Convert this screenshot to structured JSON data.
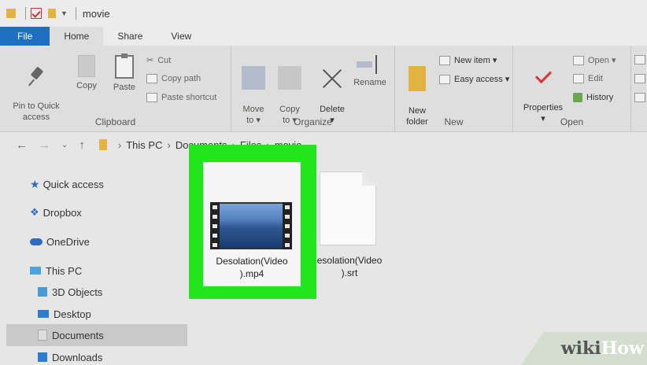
{
  "window": {
    "title": "movie"
  },
  "ribbon": {
    "tabs": [
      "File",
      "Home",
      "Share",
      "View"
    ],
    "clipboard": {
      "label": "Clipboard",
      "pin": "Pin to Quick\naccess",
      "copy": "Copy",
      "paste": "Paste",
      "cut": "Cut",
      "copy_path": "Copy path",
      "paste_shortcut": "Paste shortcut"
    },
    "organize": {
      "label": "Organize",
      "move_to": "Move\nto ▾",
      "copy_to": "Copy\nto ▾",
      "delete": "Delete\n▾",
      "rename": "Rename"
    },
    "new": {
      "label": "New",
      "new_folder": "New\nfolder",
      "new_item": "New item ▾",
      "easy_access": "Easy access ▾"
    },
    "open": {
      "label": "Open",
      "properties": "Properties\n▾",
      "open": "Open ▾",
      "edit": "Edit",
      "history": "History"
    }
  },
  "address": {
    "crumbs": [
      "This PC",
      "Documents",
      "Files",
      "movie"
    ]
  },
  "nav": [
    {
      "label": "Quick access"
    },
    {
      "label": "Dropbox"
    },
    {
      "label": "OneDrive"
    },
    {
      "label": "This PC"
    },
    {
      "label": "3D Objects"
    },
    {
      "label": "Desktop"
    },
    {
      "label": "Documents"
    },
    {
      "label": "Downloads"
    }
  ],
  "files": [
    {
      "name_line1": "Desolation(Video",
      "name_line2": ").mp4"
    },
    {
      "name_line1": "esolation(Video",
      "name_line2": ").srt"
    }
  ],
  "watermark": {
    "w1": "wiki",
    "w2": "How"
  },
  "colors": {
    "highlight": "#22e61c",
    "file_tab": "#1e6fc1"
  }
}
